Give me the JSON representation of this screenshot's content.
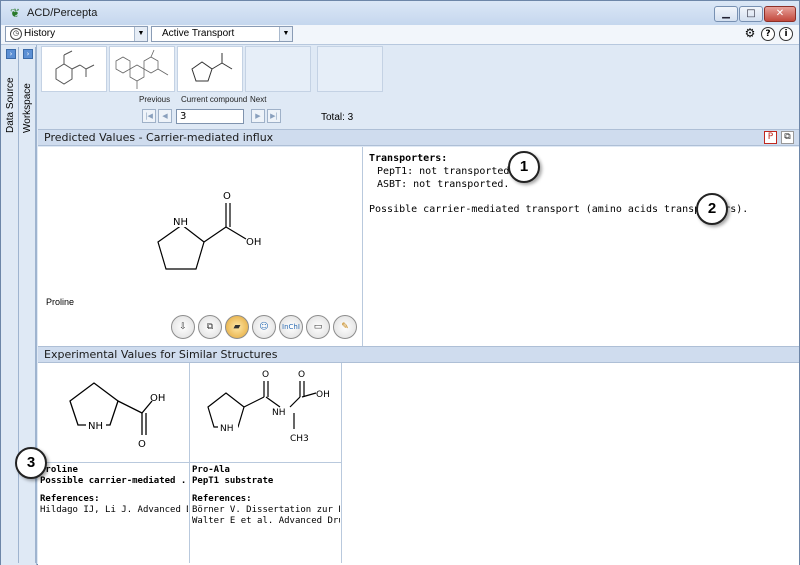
{
  "window": {
    "title": "ACD/Percepta",
    "controls": [
      "minimize",
      "maximize",
      "close"
    ]
  },
  "toolbar": {
    "history_combo": "History",
    "transport_combo": "Active Transport",
    "icons": [
      "settings-icon",
      "help-icon",
      "info-icon"
    ]
  },
  "side_tabs": [
    "Data Source",
    "Workspace"
  ],
  "navigation": {
    "previous_label": "Previous",
    "current_label": "Current compound",
    "next_label": "Next",
    "current_value": "3",
    "total_label": "Total: 3"
  },
  "predicted": {
    "header": "Predicted Values - Carrier-mediated influx",
    "compound_name": "Proline",
    "structure_labels": {
      "nh": "NH",
      "o": "O",
      "oh": "OH"
    },
    "transporters_title": "Transporters:",
    "lines": [
      "PepT1: not transported.",
      "ASBT: not transported."
    ],
    "conclusion": "Possible carrier-mediated transport (amino acids transporters).",
    "tool_buttons": [
      "export-icon",
      "copy-icon",
      "book-icon",
      "smile-icon",
      "inchi-icon",
      "open-folder-icon",
      "edit-icon"
    ],
    "inchi_label": "InChI"
  },
  "experimental": {
    "header": "Experimental Values for Similar Structures",
    "cards": [
      {
        "name": "Proline",
        "activity": "Possible carrier-mediated ..",
        "references_label": "References:",
        "references": [
          "Hildago IJ, Li J. Advanced Dru.."
        ],
        "labels": {
          "nh": "NH",
          "o": "O",
          "oh": "OH"
        }
      },
      {
        "name": "Pro-Ala",
        "activity": "PepT1 substrate",
        "references_label": "References:",
        "references": [
          "Börner V. Dissertation zur Erla..",
          "Walter E et al. Advanced Drug.."
        ],
        "labels": {
          "nh": "NH",
          "nh2": "NH",
          "o": "O",
          "o2": "O",
          "oh": "OH",
          "ch3": "CH3"
        }
      }
    ]
  },
  "callouts": [
    "1",
    "2",
    "3"
  ],
  "colors": {
    "header_bg": "#cfdcee",
    "window_bg": "#dfe9f5",
    "accent": "#5b8fd4"
  }
}
